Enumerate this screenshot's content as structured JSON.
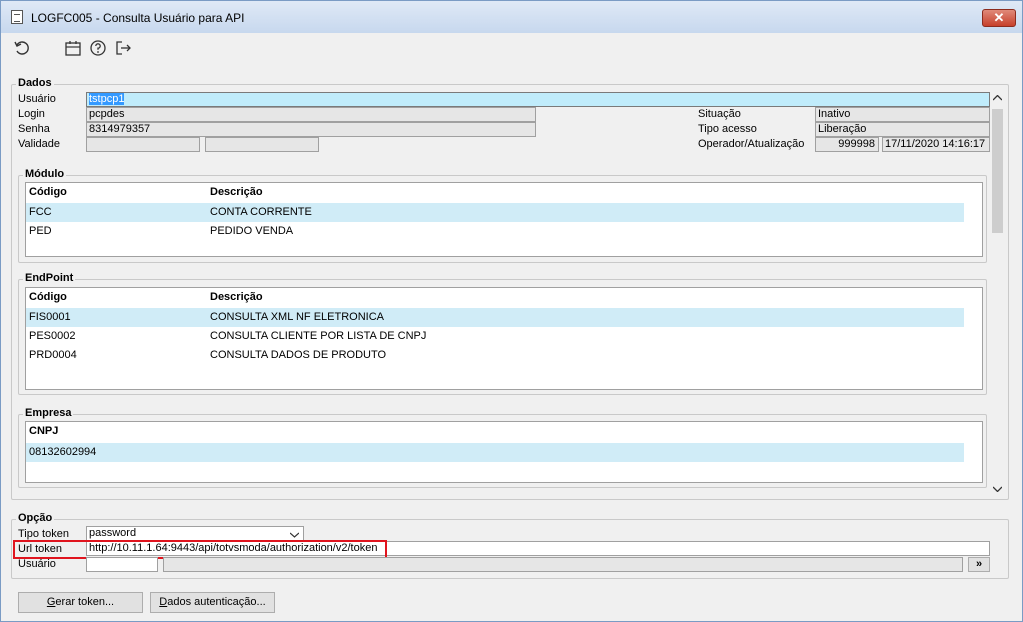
{
  "window": {
    "title": "LOGFC005 - Consulta Usuário para API",
    "close_label": "✕"
  },
  "toolbar": {
    "refresh_icon": "refresh-icon",
    "calendar_icon": "calendar-icon",
    "help_icon": "help-icon",
    "exit_icon": "exit-icon"
  },
  "dados": {
    "title": "Dados",
    "usuario_label": "Usuário",
    "usuario_value": "tstpcp1",
    "login_label": "Login",
    "login_value": "pcpdes",
    "senha_label": "Senha",
    "senha_value": "8314979357",
    "validade_label": "Validade",
    "validade_from": "",
    "validade_to": "",
    "situacao_label": "Situação",
    "situacao_value": "Inativo",
    "tipo_acesso_label": "Tipo acesso",
    "tipo_acesso_value": "Liberação",
    "operador_label": "Operador/Atualização",
    "operador_value": "999998",
    "atualizacao_value": "17/11/2020 14:16:17"
  },
  "modulo": {
    "title": "Módulo",
    "headers": [
      "Código",
      "Descrição"
    ],
    "rows": [
      [
        "FCC",
        "CONTA CORRENTE"
      ],
      [
        "PED",
        "PEDIDO VENDA"
      ]
    ]
  },
  "endpoint": {
    "title": "EndPoint",
    "headers": [
      "Código",
      "Descrição"
    ],
    "rows": [
      [
        "FIS0001",
        "CONSULTA XML NF ELETRONICA"
      ],
      [
        "PES0002",
        "CONSULTA CLIENTE POR LISTA DE CNPJ"
      ],
      [
        "PRD0004",
        "CONSULTA DADOS DE PRODUTO"
      ]
    ]
  },
  "empresa": {
    "title": "Empresa",
    "headers": [
      "CNPJ"
    ],
    "rows": [
      [
        "08132602994"
      ]
    ]
  },
  "opcao": {
    "title": "Opção",
    "tipo_token_label": "Tipo token",
    "tipo_token_value": "password",
    "url_token_label": "Url token",
    "url_token_value": "http://10.11.1.64:9443/api/totvsmoda/authorization/v2/token",
    "usuario_label": "Usuário",
    "usuario_value": "",
    "usuario_name": "",
    "browse_label": "»"
  },
  "buttons": {
    "gerar_token_accel": "G",
    "gerar_token_rest": "erar token...",
    "dados_auth_accel": "D",
    "dados_auth_rest": "ados autenticação..."
  },
  "colors": {
    "selected_row": "#d0ecf7",
    "highlight_box": "#e0141e",
    "selected_text": "#3399ff"
  }
}
